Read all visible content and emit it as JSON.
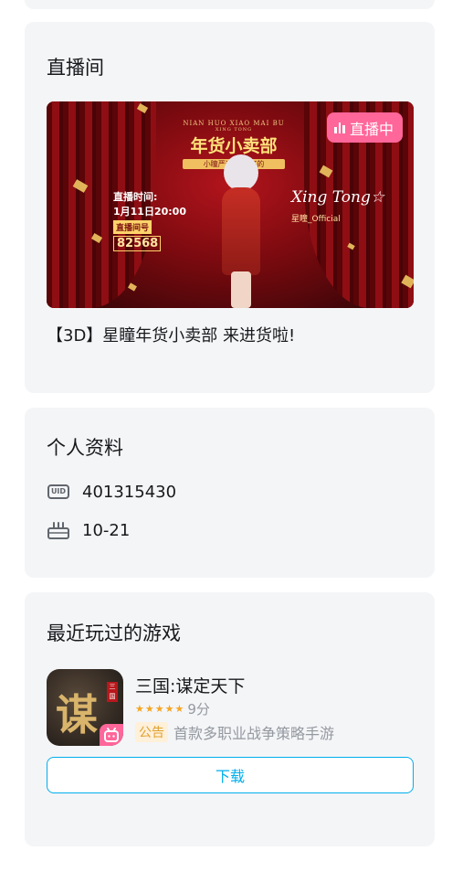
{
  "live_section": {
    "title": "直播间",
    "badge_label": "直播中",
    "stream_title": "【3D】星瞳年货小卖部 来进货啦!",
    "cover": {
      "banner_en": "NIAN HUO XIAO MAI BU",
      "banner_en_sub": "XING TONG",
      "banner_cn": "年货小卖部",
      "banner_sub": "小瞳严选·买点好的",
      "time_label": "直播时间:",
      "time_value": "1月11日20:00",
      "room_label": "直播间号",
      "room_number": "82568",
      "signature": "Xing Tong☆",
      "official": "星瞳_Official"
    }
  },
  "profile": {
    "title": "个人资料",
    "uid_icon_text": "UID",
    "uid": "401315430",
    "birthday": "10-21"
  },
  "games": {
    "title": "最近玩过的游戏",
    "item": {
      "name": "三国:谋定天下",
      "icon_glyph": "谋",
      "icon_tag": "三国",
      "stars": 5,
      "score": "9分",
      "notice_tag": "公告",
      "description": "首款多职业战争策略手游",
      "download_label": "下载"
    }
  },
  "colors": {
    "accent_pink": "#ff6699",
    "accent_blue": "#00aeec",
    "star": "#f5a623",
    "card_bg": "#f4f5f7"
  }
}
